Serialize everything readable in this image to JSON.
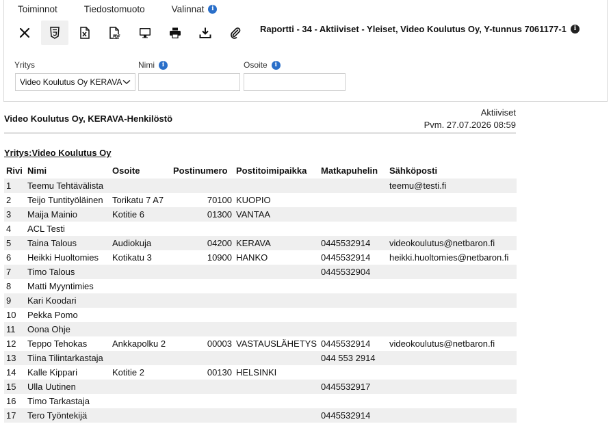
{
  "menu": {
    "items": [
      "Toiminnot",
      "Tiedostomuoto",
      "Valinnat"
    ]
  },
  "toolbar": {
    "icons": [
      "close-icon",
      "html5-icon",
      "excel-icon",
      "pdf-icon",
      "monitor-icon",
      "print-icon",
      "download-icon",
      "attachment-icon"
    ],
    "active": "html5-icon",
    "report_title": "Raportti - 34 - Aktiiviset - Yleiset, Video Koulutus Oy, Y-tunnus 7061177-1"
  },
  "filters": {
    "yritys_label": "Yritys",
    "yritys_value": "Video Koulutus Oy KERAVA",
    "nimi_label": "Nimi",
    "nimi_value": "",
    "osoite_label": "Osoite",
    "osoite_value": ""
  },
  "report": {
    "company": "Video Koulutus Oy, KERAVA-Henkilöstö",
    "status": "Aktiiviset",
    "date": "Pvm. 27.07.2026 08:59",
    "group": "Yritys:Video Koulutus Oy",
    "columns": [
      "Rivi",
      "Nimi",
      "Osoite",
      "Postinumero",
      "Postitoimipaikka",
      "Matkapuhelin",
      "Sähköposti"
    ],
    "rows": [
      [
        "1",
        "Teemu Tehtävälista",
        "",
        "",
        "",
        "",
        "teemu@testi.fi"
      ],
      [
        "2",
        "Teijo Tuntityöläinen",
        "Torikatu 7 A7",
        "70100",
        "KUOPIO",
        "",
        ""
      ],
      [
        "3",
        "Maija Mainio",
        "Kotitie 6",
        "01300",
        "VANTAA",
        "",
        ""
      ],
      [
        "4",
        "ACL Testi",
        "",
        "",
        "",
        "",
        ""
      ],
      [
        "5",
        "Taina Talous",
        "Audiokuja",
        "04200",
        "KERAVA",
        "0445532914",
        "videokoulutus@netbaron.fi"
      ],
      [
        "6",
        "Heikki Huoltomies",
        "Kotikatu 3",
        "10900",
        "HANKO",
        "0445532914",
        "heikki.huoltomies@netbaron.fi"
      ],
      [
        "7",
        "Timo Talous",
        "",
        "",
        "",
        "0445532904",
        ""
      ],
      [
        "8",
        "Matti Myyntimies",
        "",
        "",
        "",
        "",
        ""
      ],
      [
        "9",
        "Kari Koodari",
        "",
        "",
        "",
        "",
        ""
      ],
      [
        "10",
        "Pekka Pomo",
        "",
        "",
        "",
        "",
        ""
      ],
      [
        "11",
        "Oona Ohje",
        "",
        "",
        "",
        "",
        ""
      ],
      [
        "12",
        "Teppo Tehokas",
        "Ankkapolku 2",
        "00003",
        "VASTAUSLÄHETYS",
        "0445532914",
        "videokoulutus@netbaron.fi"
      ],
      [
        "13",
        "Tiina Tilintarkastaja",
        "",
        "",
        "",
        "044 553 2914",
        ""
      ],
      [
        "14",
        "Kalle Kippari",
        "Kotitie 2",
        "00130",
        "HELSINKI",
        "",
        ""
      ],
      [
        "15",
        "Ulla Uutinen",
        "",
        "",
        "",
        "0445532917",
        ""
      ],
      [
        "16",
        "Timo Tarkastaja",
        "",
        "",
        "",
        "",
        ""
      ],
      [
        "17",
        "Tero Työntekijä",
        "",
        "",
        "",
        "0445532914",
        ""
      ]
    ]
  }
}
